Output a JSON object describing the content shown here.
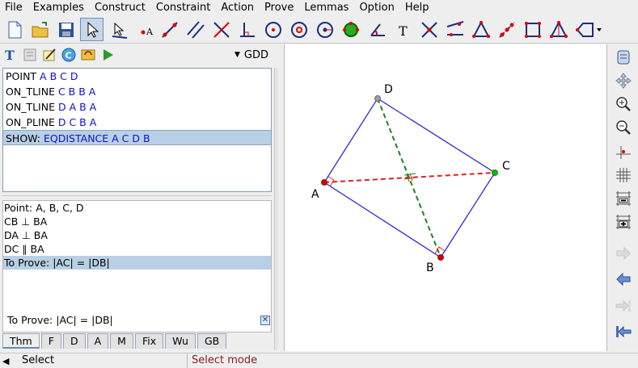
{
  "menu": [
    "File",
    "Examples",
    "Construct",
    "Constraint",
    "Action",
    "Prove",
    "Lemmas",
    "Option",
    "Help"
  ],
  "left_toolbar": {
    "mode_select": "GDD"
  },
  "construction": [
    {
      "keyword": "POINT",
      "args": "A B C D",
      "selected": false
    },
    {
      "keyword": "ON_TLINE",
      "args": "C B B A",
      "selected": false
    },
    {
      "keyword": "ON_TLINE",
      "args": "D A B A",
      "selected": false
    },
    {
      "keyword": "ON_PLINE",
      "args": "D C B A",
      "selected": false
    },
    {
      "keyword": "SHOW:",
      "args": "EQDISTANCE A C D B",
      "selected": true
    }
  ],
  "theorem": {
    "lines": [
      {
        "text": "Point: A, B, C, D",
        "selected": false
      },
      {
        "text": "CB ⊥ BA",
        "selected": false
      },
      {
        "text": "DA ⊥ BA",
        "selected": false
      },
      {
        "text": "DC ∥ BA",
        "selected": false
      },
      {
        "text": "To Prove: |AC| = |DB|",
        "selected": true
      }
    ],
    "status": "To Prove: |AC| = |DB|",
    "close_symbol": "✕"
  },
  "tabs": [
    {
      "label": "Thm",
      "active": true
    },
    {
      "label": "F",
      "active": false
    },
    {
      "label": "D",
      "active": false
    },
    {
      "label": "A",
      "active": false
    },
    {
      "label": "M",
      "active": false
    },
    {
      "label": "Fix",
      "active": false
    },
    {
      "label": "Wu",
      "active": false
    },
    {
      "label": "GB",
      "active": false
    }
  ],
  "figure": {
    "points": [
      {
        "name": "A",
        "color": "#d40000"
      },
      {
        "name": "B",
        "color": "#d40000"
      },
      {
        "name": "C",
        "color": "#00c000"
      },
      {
        "name": "D",
        "color": "#a0a0a0"
      }
    ],
    "colors": {
      "quad": "#2020d0",
      "diag_ac": "#e02020",
      "diag_db": "#208020"
    }
  },
  "toolbar_icons": [
    "new-file-icon",
    "open-file-icon",
    "save-icon",
    "select-arrow-icon",
    "move-point-icon",
    "point-icon",
    "line-icon",
    "parallel-icon",
    "perpendicular-icon",
    "foot-icon",
    "circle-icon",
    "circle3-icon",
    "circle-center-icon",
    "compass-icon",
    "angle-icon",
    "text-icon",
    "intersection-icon",
    "polygon-icon",
    "triangle-icon",
    "mirror-icon",
    "square-icon",
    "iso-triangle-icon",
    "more-shapes-icon"
  ],
  "right_icons": [
    "notes-icon",
    "move-view-icon",
    "zoom-in-icon",
    "zoom-out-icon",
    "crosshair-icon",
    "grid-icon",
    "grid-minus-icon",
    "grid-plus-icon",
    "arrow-right-icon",
    "arrow-left-icon",
    "step-forward-icon",
    "step-first-icon"
  ],
  "status": {
    "left": "Select",
    "right": "Select mode",
    "accent": "#8b1a1a"
  }
}
